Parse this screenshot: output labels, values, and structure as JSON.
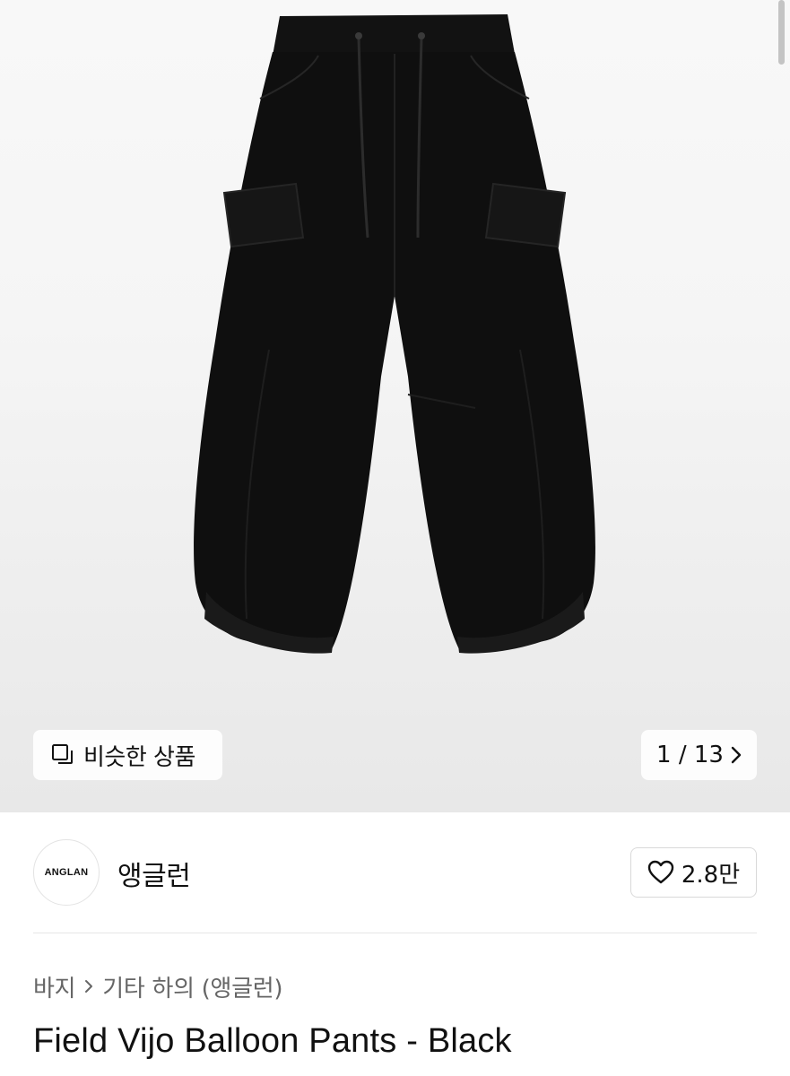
{
  "gallery": {
    "image_alt": "Field Vijo Balloon Pants - Black",
    "similar_label": "비슷한 상품",
    "similar_icon": "copy-icon",
    "page_counter": "1 / 13",
    "page_icon": "chevron-right-icon"
  },
  "shop": {
    "logo_text": "ANGLAN",
    "name": "앵글런",
    "likes": "2.8만",
    "like_icon": "heart-outline-icon"
  },
  "breadcrumb": {
    "category": "바지",
    "subcategory": "기타 하의 (앵글런)"
  },
  "product": {
    "title": "Field Vijo Balloon Pants - Black"
  },
  "colors": {
    "garment": "#0f0f0f",
    "background_top": "#f8f8f8",
    "background_bottom": "#e8e8e8",
    "text_primary": "#111111",
    "text_secondary": "#666666"
  }
}
